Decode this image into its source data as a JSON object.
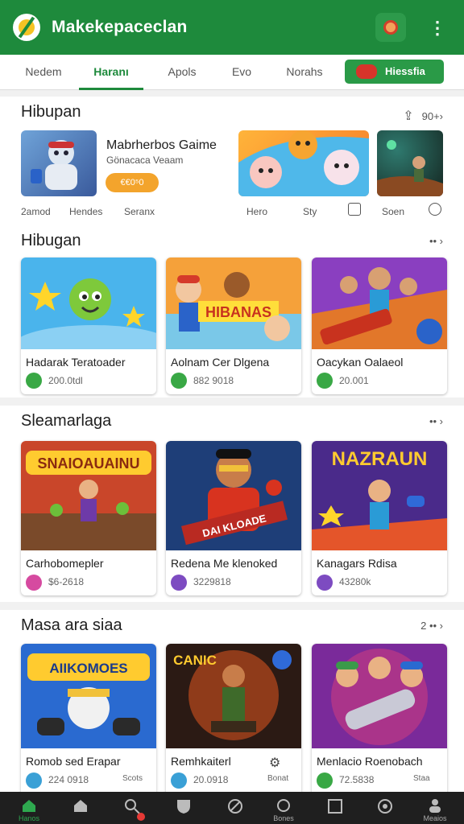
{
  "app": {
    "title": "Makekepaceclan"
  },
  "tabs": [
    {
      "label": "Nedem"
    },
    {
      "label": "Haranı"
    },
    {
      "label": "Apols"
    },
    {
      "label": "Evo"
    },
    {
      "label": "Norahs"
    }
  ],
  "tab_button": {
    "label": "Hiessfia"
  },
  "featured": {
    "title": "Hibupan",
    "more": "90+›",
    "game_title": "Mabrherbos Gaime",
    "game_sub": "Gönacaca Veaam",
    "button": "€€0⁵0",
    "labels": [
      "2amod",
      "Hendes",
      "Seranx",
      "Hero",
      "Sty",
      "Soen"
    ]
  },
  "sections": [
    {
      "title": "Hibugan",
      "more": "•• ›",
      "cards": [
        {
          "name": "Hadarak Teratoader",
          "meta": "200.0tdl",
          "dot_color": "#39a845"
        },
        {
          "name": "Aolnam Cer Dlgena",
          "meta": "882 9018",
          "dot_color": "#39a845"
        },
        {
          "name": "Oacykan Oalaeol",
          "meta": "20.001",
          "dot_color": "#39a845"
        }
      ]
    },
    {
      "title": "Sleamarlaga",
      "more": "•• ›",
      "cards": [
        {
          "name": "Carhobomepler",
          "meta": "$6-2618",
          "dot_color": "#d64aa0"
        },
        {
          "name": "Redena Me klenoked",
          "meta": "3229818",
          "dot_color": "#7d4bc1"
        },
        {
          "name": "Kanagars Rdisa",
          "meta": "43280k",
          "dot_color": "#7d4bc1"
        }
      ]
    },
    {
      "title": "Masa ara siaa",
      "more": "2 •• ›",
      "cards": [
        {
          "name": "Romob sed Erapar",
          "meta": "224 0918",
          "dot_color": "#3aa0d6",
          "side": "Scots"
        },
        {
          "name": "Remhkaiterl",
          "meta": "20.0918",
          "dot_color": "#3aa0d6",
          "side": "Bonat"
        },
        {
          "name": "Menlacio Roenobach",
          "meta": "72.5838",
          "dot_color": "#39a845",
          "side": "Staa"
        }
      ]
    }
  ],
  "bottom_nav": [
    {
      "icon": "home-icon",
      "label": "Hanos"
    },
    {
      "icon": "house-icon",
      "label": ""
    },
    {
      "icon": "search-icon",
      "label": ""
    },
    {
      "icon": "shield-icon",
      "label": ""
    },
    {
      "icon": "basketball-icon",
      "label": ""
    },
    {
      "icon": "circle-icon",
      "label": "Bones"
    },
    {
      "icon": "square-icon",
      "label": ""
    },
    {
      "icon": "swirl-icon",
      "label": ""
    },
    {
      "icon": "person-icon",
      "label": "Meaios"
    }
  ],
  "colors": {
    "brand": "#1e8a3c",
    "accent": "#f3a42c",
    "nav_bg": "#1f1f1f"
  }
}
